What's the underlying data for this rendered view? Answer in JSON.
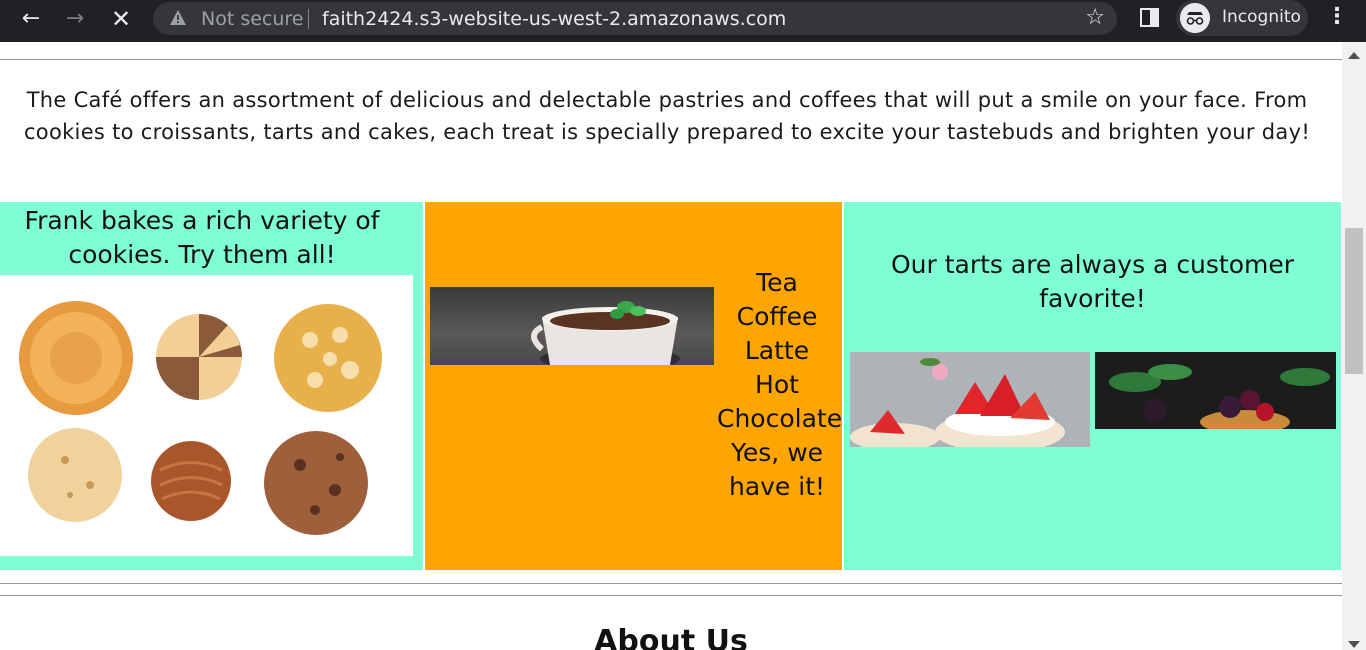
{
  "browser": {
    "security_label": "Not secure",
    "url": "faith2424.s3-website-us-west-2.amazonaws.com",
    "profile_label": "Incognito",
    "icons": [
      "back-arrow-icon",
      "forward-arrow-icon",
      "stop-loading-icon",
      "warning-icon",
      "star-icon",
      "side-panel-icon",
      "incognito-icon",
      "kebab-menu-icon"
    ]
  },
  "page": {
    "intro": "The Café offers an assortment of delicious and delectable pastries and coffees that will put a smile on your face. From cookies to croissants, tarts and cakes, each treat is specially prepared to excite your tastebuds and brighten your day!",
    "cookies_caption": "Frank bakes a rich variety of cookies. Try them all!",
    "drinks": [
      "Tea",
      "Coffee",
      "Latte",
      "Hot Chocolate",
      "Yes, we have it!"
    ],
    "tarts_caption": "Our tarts are always a customer favorite!",
    "about_heading": "About Us",
    "colors": {
      "aquamarine": "#7fffd4",
      "orange": "#ffa500"
    }
  }
}
